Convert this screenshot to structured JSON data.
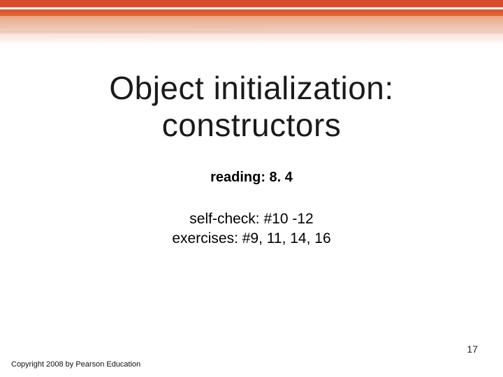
{
  "title_line1": "Object initialization:",
  "title_line2": "constructors",
  "reading": "reading: 8. 4",
  "selfcheck": "self-check: #10 -12",
  "exercises": "exercises: #9, 11, 14, 16",
  "copyright": "Copyright 2008 by Pearson Education",
  "page_number": "17"
}
